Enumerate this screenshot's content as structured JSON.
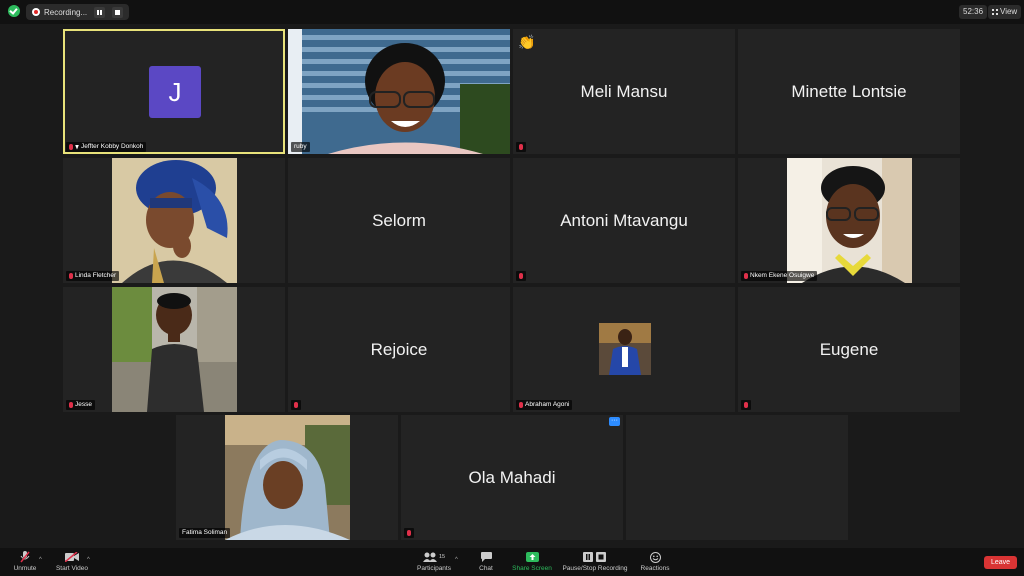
{
  "topbar": {
    "recording_label": "Recording...",
    "timer": "52:36",
    "view_label": "View"
  },
  "tiles": [
    {
      "name": "Jeffter Kobby Donkoh",
      "avatar_letter": "J",
      "type": "avatar"
    },
    {
      "name": "ruby",
      "type": "video"
    },
    {
      "name": "Meli Mansu",
      "type": "text",
      "reaction": "clap"
    },
    {
      "name": "Minette Lontsie",
      "type": "text"
    },
    {
      "name": "Linda Fletcher",
      "type": "video"
    },
    {
      "name": "Selorm",
      "type": "text"
    },
    {
      "name": "Antoni Mtavangu",
      "type": "text"
    },
    {
      "name": "Nkem Ekene Osuigwe",
      "type": "video"
    },
    {
      "name": "Jesse",
      "type": "video"
    },
    {
      "name": "Rejoice",
      "type": "text"
    },
    {
      "name": "Abraham Agoni",
      "type": "video"
    },
    {
      "name": "Eugene",
      "type": "text"
    },
    {
      "name": "Fatima Soliman",
      "type": "video"
    },
    {
      "name": "Ola Mahadi",
      "type": "text"
    }
  ],
  "toolbar": {
    "unmute": "Unmute",
    "start_video": "Start Video",
    "participants": "Participants",
    "participants_count": "15",
    "chat": "Chat",
    "share_screen": "Share Screen",
    "pause_stop_recording": "Pause/Stop Recording",
    "reactions": "Reactions",
    "leave": "Leave"
  },
  "colors": {
    "active_speaker": "#e8e27a",
    "avatar_bg": "#5b48c4",
    "share_green": "#2dbb5d",
    "leave_red": "#d93434",
    "mic_muted": "#e0304a"
  }
}
